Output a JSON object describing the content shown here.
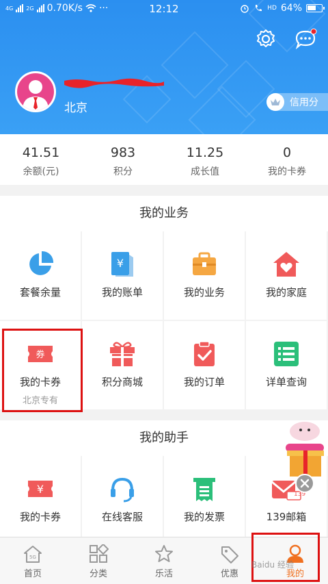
{
  "status_bar": {
    "network_left": "4G",
    "network_right": "2G",
    "speed": "0.70K/s",
    "more": "···",
    "time": "12:12",
    "hd": "HD",
    "battery": "64%",
    "battery_level": 0.64
  },
  "header": {
    "city": "北京",
    "credit_label": "信用分"
  },
  "stats": [
    {
      "value": "41.51",
      "label": "余额(元)"
    },
    {
      "value": "983",
      "label": "积分"
    },
    {
      "value": "11.25",
      "label": "成长值"
    },
    {
      "value": "0",
      "label": "我的卡券"
    }
  ],
  "business": {
    "title": "我的业务",
    "items": [
      {
        "label": "套餐余量",
        "icon": "pie-chart-icon",
        "sub": ""
      },
      {
        "label": "我的账单",
        "icon": "bill-icon",
        "sub": ""
      },
      {
        "label": "我的业务",
        "icon": "briefcase-icon",
        "sub": ""
      },
      {
        "label": "我的家庭",
        "icon": "home-heart-icon",
        "sub": ""
      },
      {
        "label": "我的卡券",
        "icon": "coupon-icon",
        "sub": "北京专有"
      },
      {
        "label": "积分商城",
        "icon": "gift-icon",
        "sub": ""
      },
      {
        "label": "我的订单",
        "icon": "clipboard-check-icon",
        "sub": ""
      },
      {
        "label": "详单查询",
        "icon": "list-icon",
        "sub": ""
      }
    ]
  },
  "assistant": {
    "title": "我的助手",
    "items": [
      {
        "label": "我的卡券",
        "icon": "coupon-yen-icon"
      },
      {
        "label": "在线客服",
        "icon": "headset-icon"
      },
      {
        "label": "我的发票",
        "icon": "invoice-icon"
      },
      {
        "label": "139邮箱",
        "icon": "mail-139-icon"
      }
    ],
    "mail_badge": "139"
  },
  "bottom_nav": [
    {
      "label": "首页",
      "icon": "home-icon",
      "active": false
    },
    {
      "label": "分类",
      "icon": "category-icon",
      "active": false
    },
    {
      "label": "乐活",
      "icon": "star-icon",
      "active": false
    },
    {
      "label": "优惠",
      "icon": "tag-icon",
      "active": false
    },
    {
      "label": "我的",
      "icon": "user-icon",
      "active": true
    }
  ],
  "watermark": "Baidu 经验",
  "colors": {
    "header_blue": "#2b8ff0",
    "accent_orange": "#f07020",
    "highlight_red": "#d11111"
  }
}
